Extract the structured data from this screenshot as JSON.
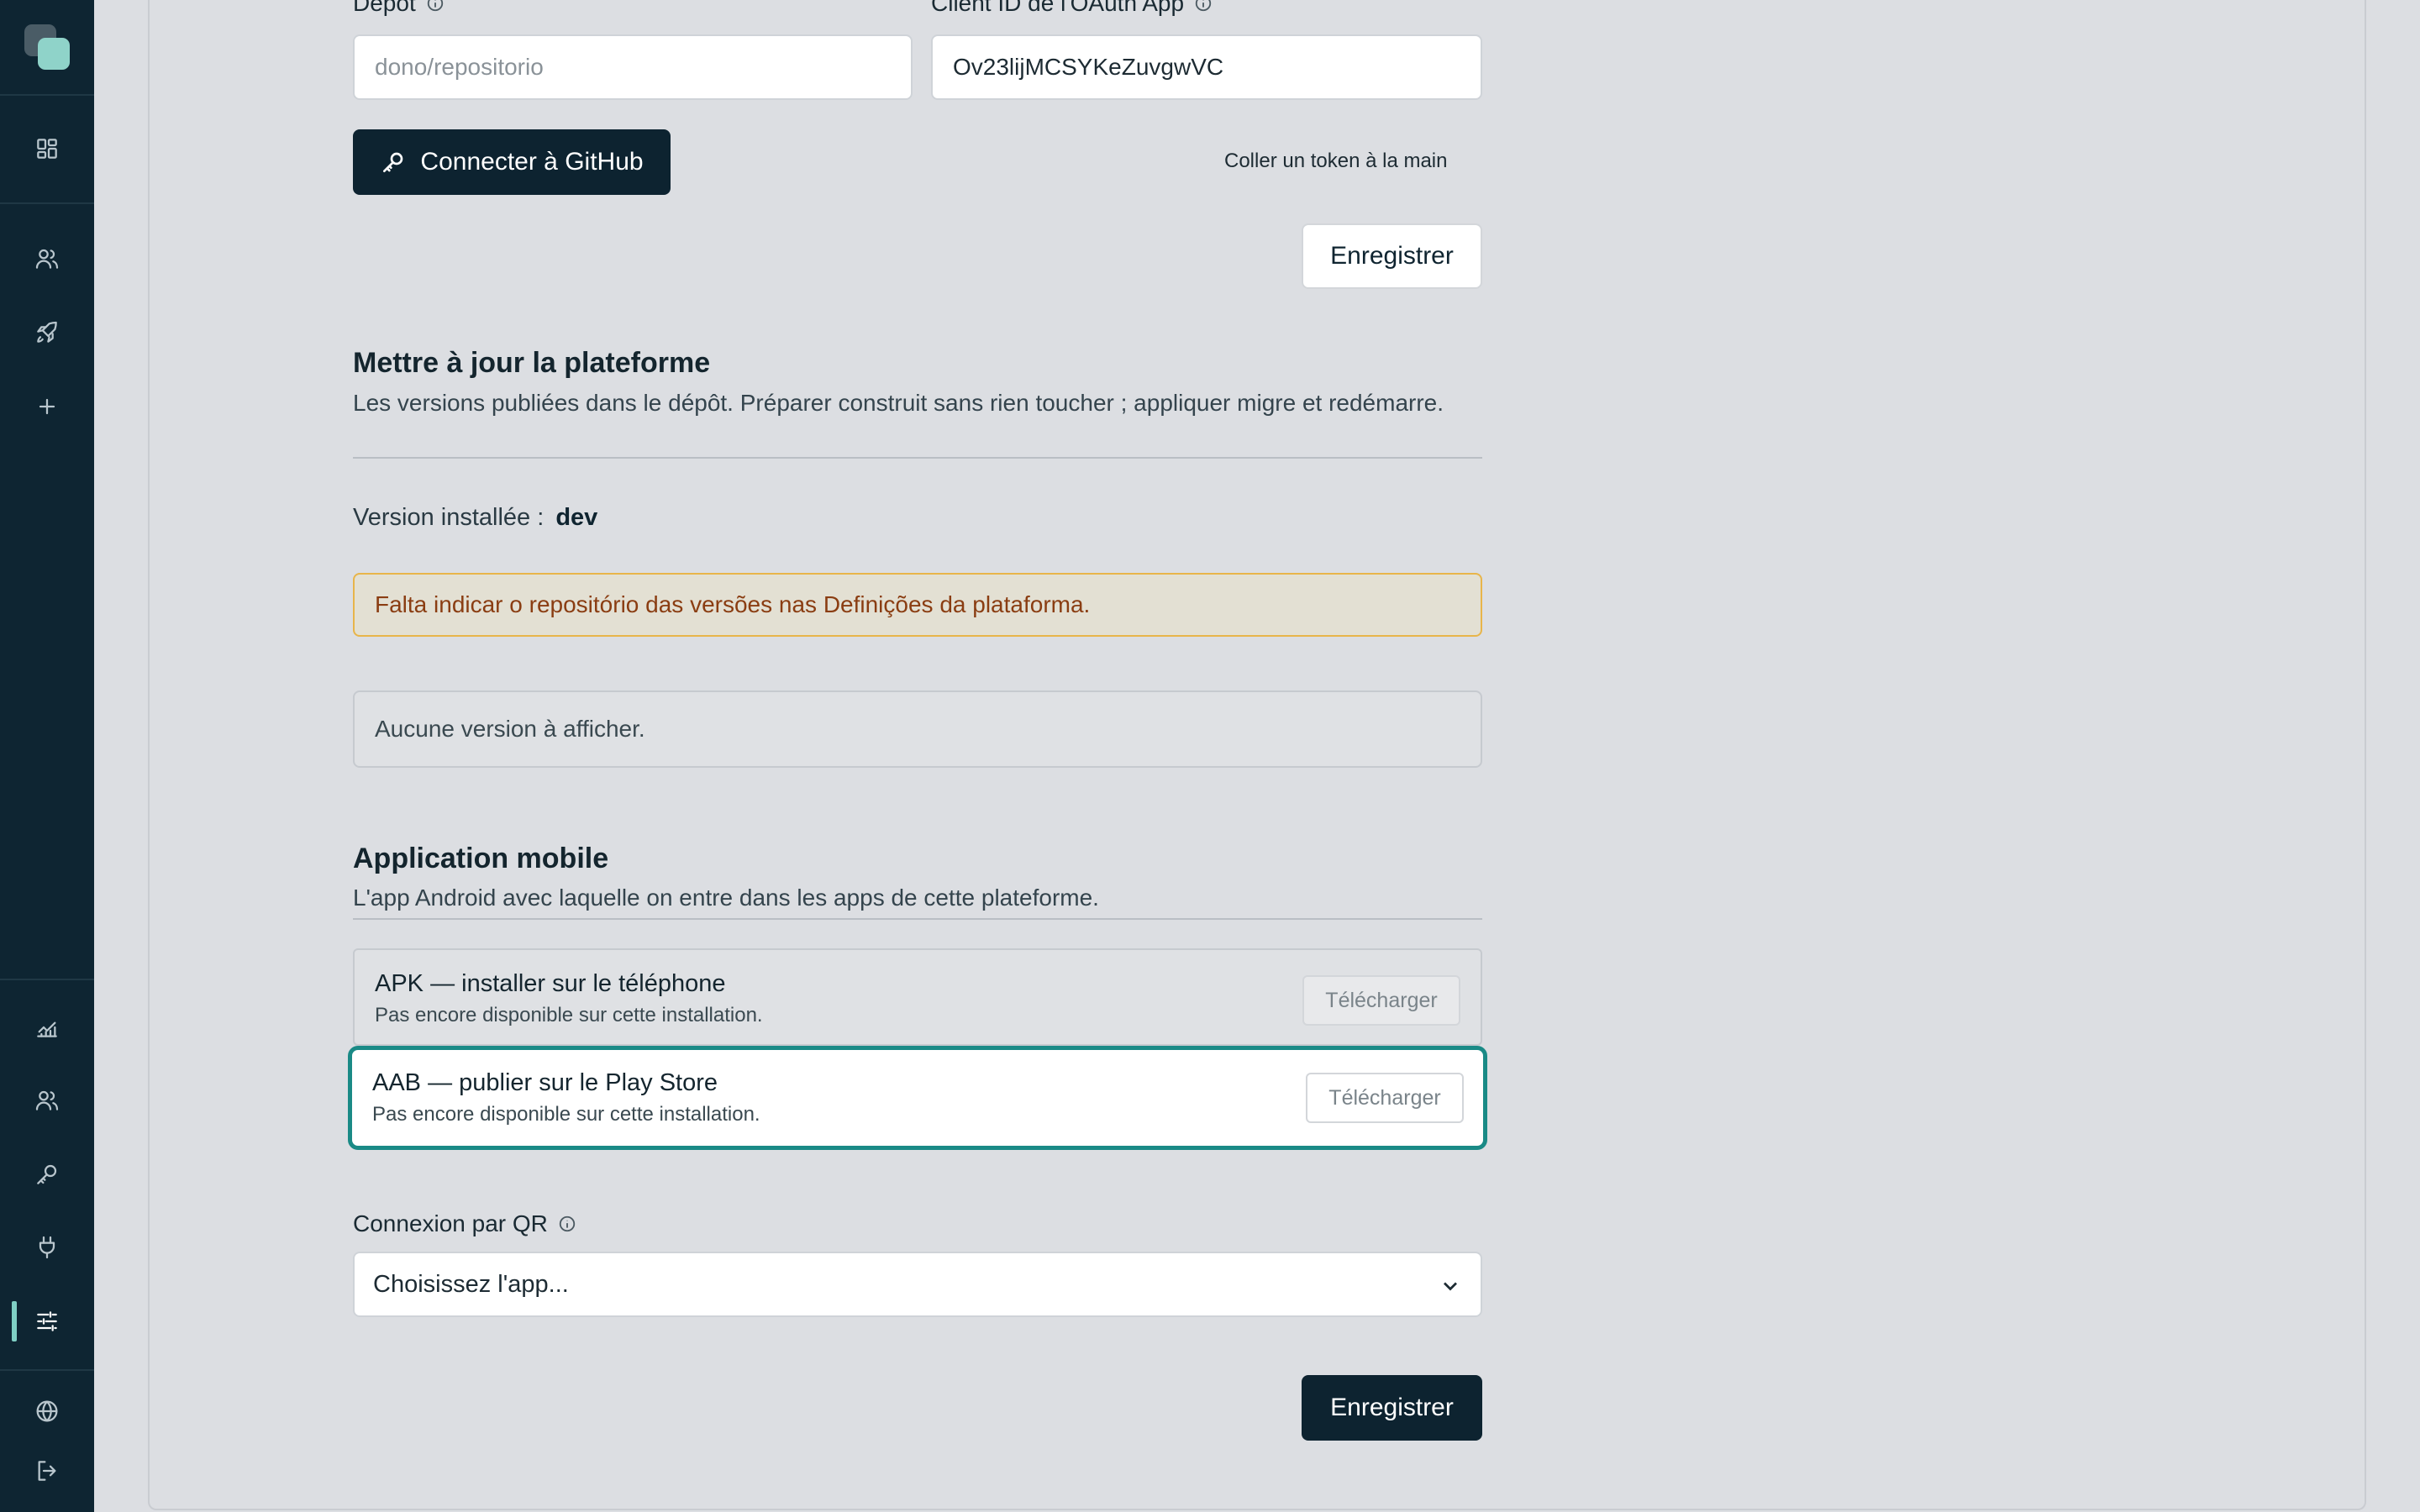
{
  "sidebar": {
    "top_items": [
      {
        "icon": "dashboard-icon"
      },
      {
        "icon": "users-icon"
      },
      {
        "icon": "rocket-icon"
      },
      {
        "icon": "plus-icon"
      }
    ],
    "bottom_items": [
      {
        "icon": "analytics-icon"
      },
      {
        "icon": "users-icon"
      },
      {
        "icon": "key-icon"
      },
      {
        "icon": "plug-icon"
      },
      {
        "icon": "sliders-icon",
        "active": true
      },
      {
        "icon": "globe-icon"
      },
      {
        "icon": "logout-icon"
      }
    ]
  },
  "repo": {
    "depot_label": "Depot",
    "depot_placeholder": "dono/repositorio",
    "client_id_label": "Client ID de l'OAuth App",
    "client_id_value": "Ov23lijMCSYKeZuvgwVC",
    "connect_button": "Connecter à GitHub",
    "paste_token_link": "Coller un token à la main",
    "save_button": "Enregistrer"
  },
  "platform_update": {
    "title": "Mettre à jour la plateforme",
    "description": "Les versions publiées dans le dépôt. Préparer construit sans rien toucher ; appliquer migre et redémarre.",
    "installed_label": "Version installée :",
    "installed_value": "dev",
    "warning": "Falta indicar o repositório das versões nas Definições da plataforma.",
    "empty": "Aucune version à afficher."
  },
  "mobile_app": {
    "title": "Application mobile",
    "description": "L'app Android avec laquelle on entre dans les apps de cette plateforme.",
    "downloads": [
      {
        "title": "APK — installer sur le téléphone",
        "subtitle": "Pas encore disponible sur cette installation.",
        "button": "Télécharger"
      },
      {
        "title": "AAB — publier sur le Play Store",
        "subtitle": "Pas encore disponible sur cette installation.",
        "button": "Télécharger"
      }
    ],
    "qr_label": "Connexion par QR",
    "qr_select_value": "Choisissez l'app...",
    "save_button": "Enregistrer"
  }
}
